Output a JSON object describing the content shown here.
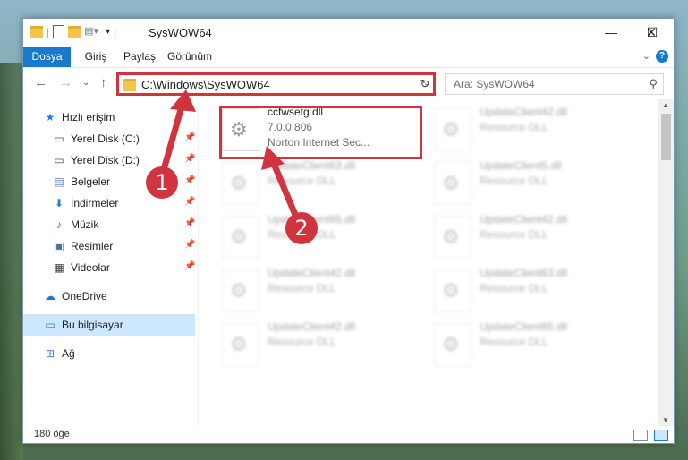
{
  "window": {
    "title": "SysWOW64",
    "controls": {
      "minimize": "—",
      "maximize": "☐",
      "close": "✕"
    }
  },
  "ribbon": {
    "tabs": [
      "Dosya",
      "Giriş",
      "Paylaş",
      "Görünüm"
    ],
    "help": "?"
  },
  "nav": {
    "address": "C:\\Windows\\SysWOW64",
    "search_placeholder": "Ara: SysWOW64"
  },
  "sidebar": {
    "quick_access": "Hızlı erişim",
    "items": [
      {
        "label": "Yerel Disk (C:)",
        "icon": "drive-icon",
        "pinned": true
      },
      {
        "label": "Yerel Disk (D:)",
        "icon": "drive-icon",
        "pinned": true
      },
      {
        "label": "Belgeler",
        "icon": "documents-icon",
        "pinned": true
      },
      {
        "label": "İndirmeler",
        "icon": "download-icon",
        "pinned": true
      },
      {
        "label": "Müzik",
        "icon": "music-icon",
        "pinned": true
      },
      {
        "label": "Resimler",
        "icon": "pictures-icon",
        "pinned": true
      },
      {
        "label": "Videolar",
        "icon": "videos-icon",
        "pinned": true
      }
    ],
    "onedrive": "OneDrive",
    "this_pc": "Bu bilgisayar",
    "network": "Ağ"
  },
  "files": {
    "highlighted": {
      "name": "ccfwsetg.dll",
      "version": "7.0.0.806",
      "description": "Norton Internet Sec..."
    },
    "others": [
      {
        "name": "UpdateClient42.dll",
        "description": "Resource DLL"
      },
      {
        "name": "UpdateClient63.dll",
        "description": "Resource DLL"
      },
      {
        "name": "UpdateClient5.dll",
        "description": "Resource DLL"
      },
      {
        "name": "UpdateClient65.dll",
        "description": "Resource DLL"
      },
      {
        "name": "UpdateClient42.dll",
        "description": "Resource DLL"
      },
      {
        "name": "UpdateClient42.dll",
        "description": "Resource DLL"
      },
      {
        "name": "UpdateClient63.dll",
        "description": "Resource DLL"
      },
      {
        "name": "UpdateClient42.dll",
        "description": "Resource DLL"
      },
      {
        "name": "UpdateClient65.dll",
        "description": "Resource DLL"
      }
    ]
  },
  "status": {
    "count": "180 öğe"
  },
  "annotations": {
    "callout1": "1",
    "callout2": "2",
    "accent": "#d0353f"
  }
}
